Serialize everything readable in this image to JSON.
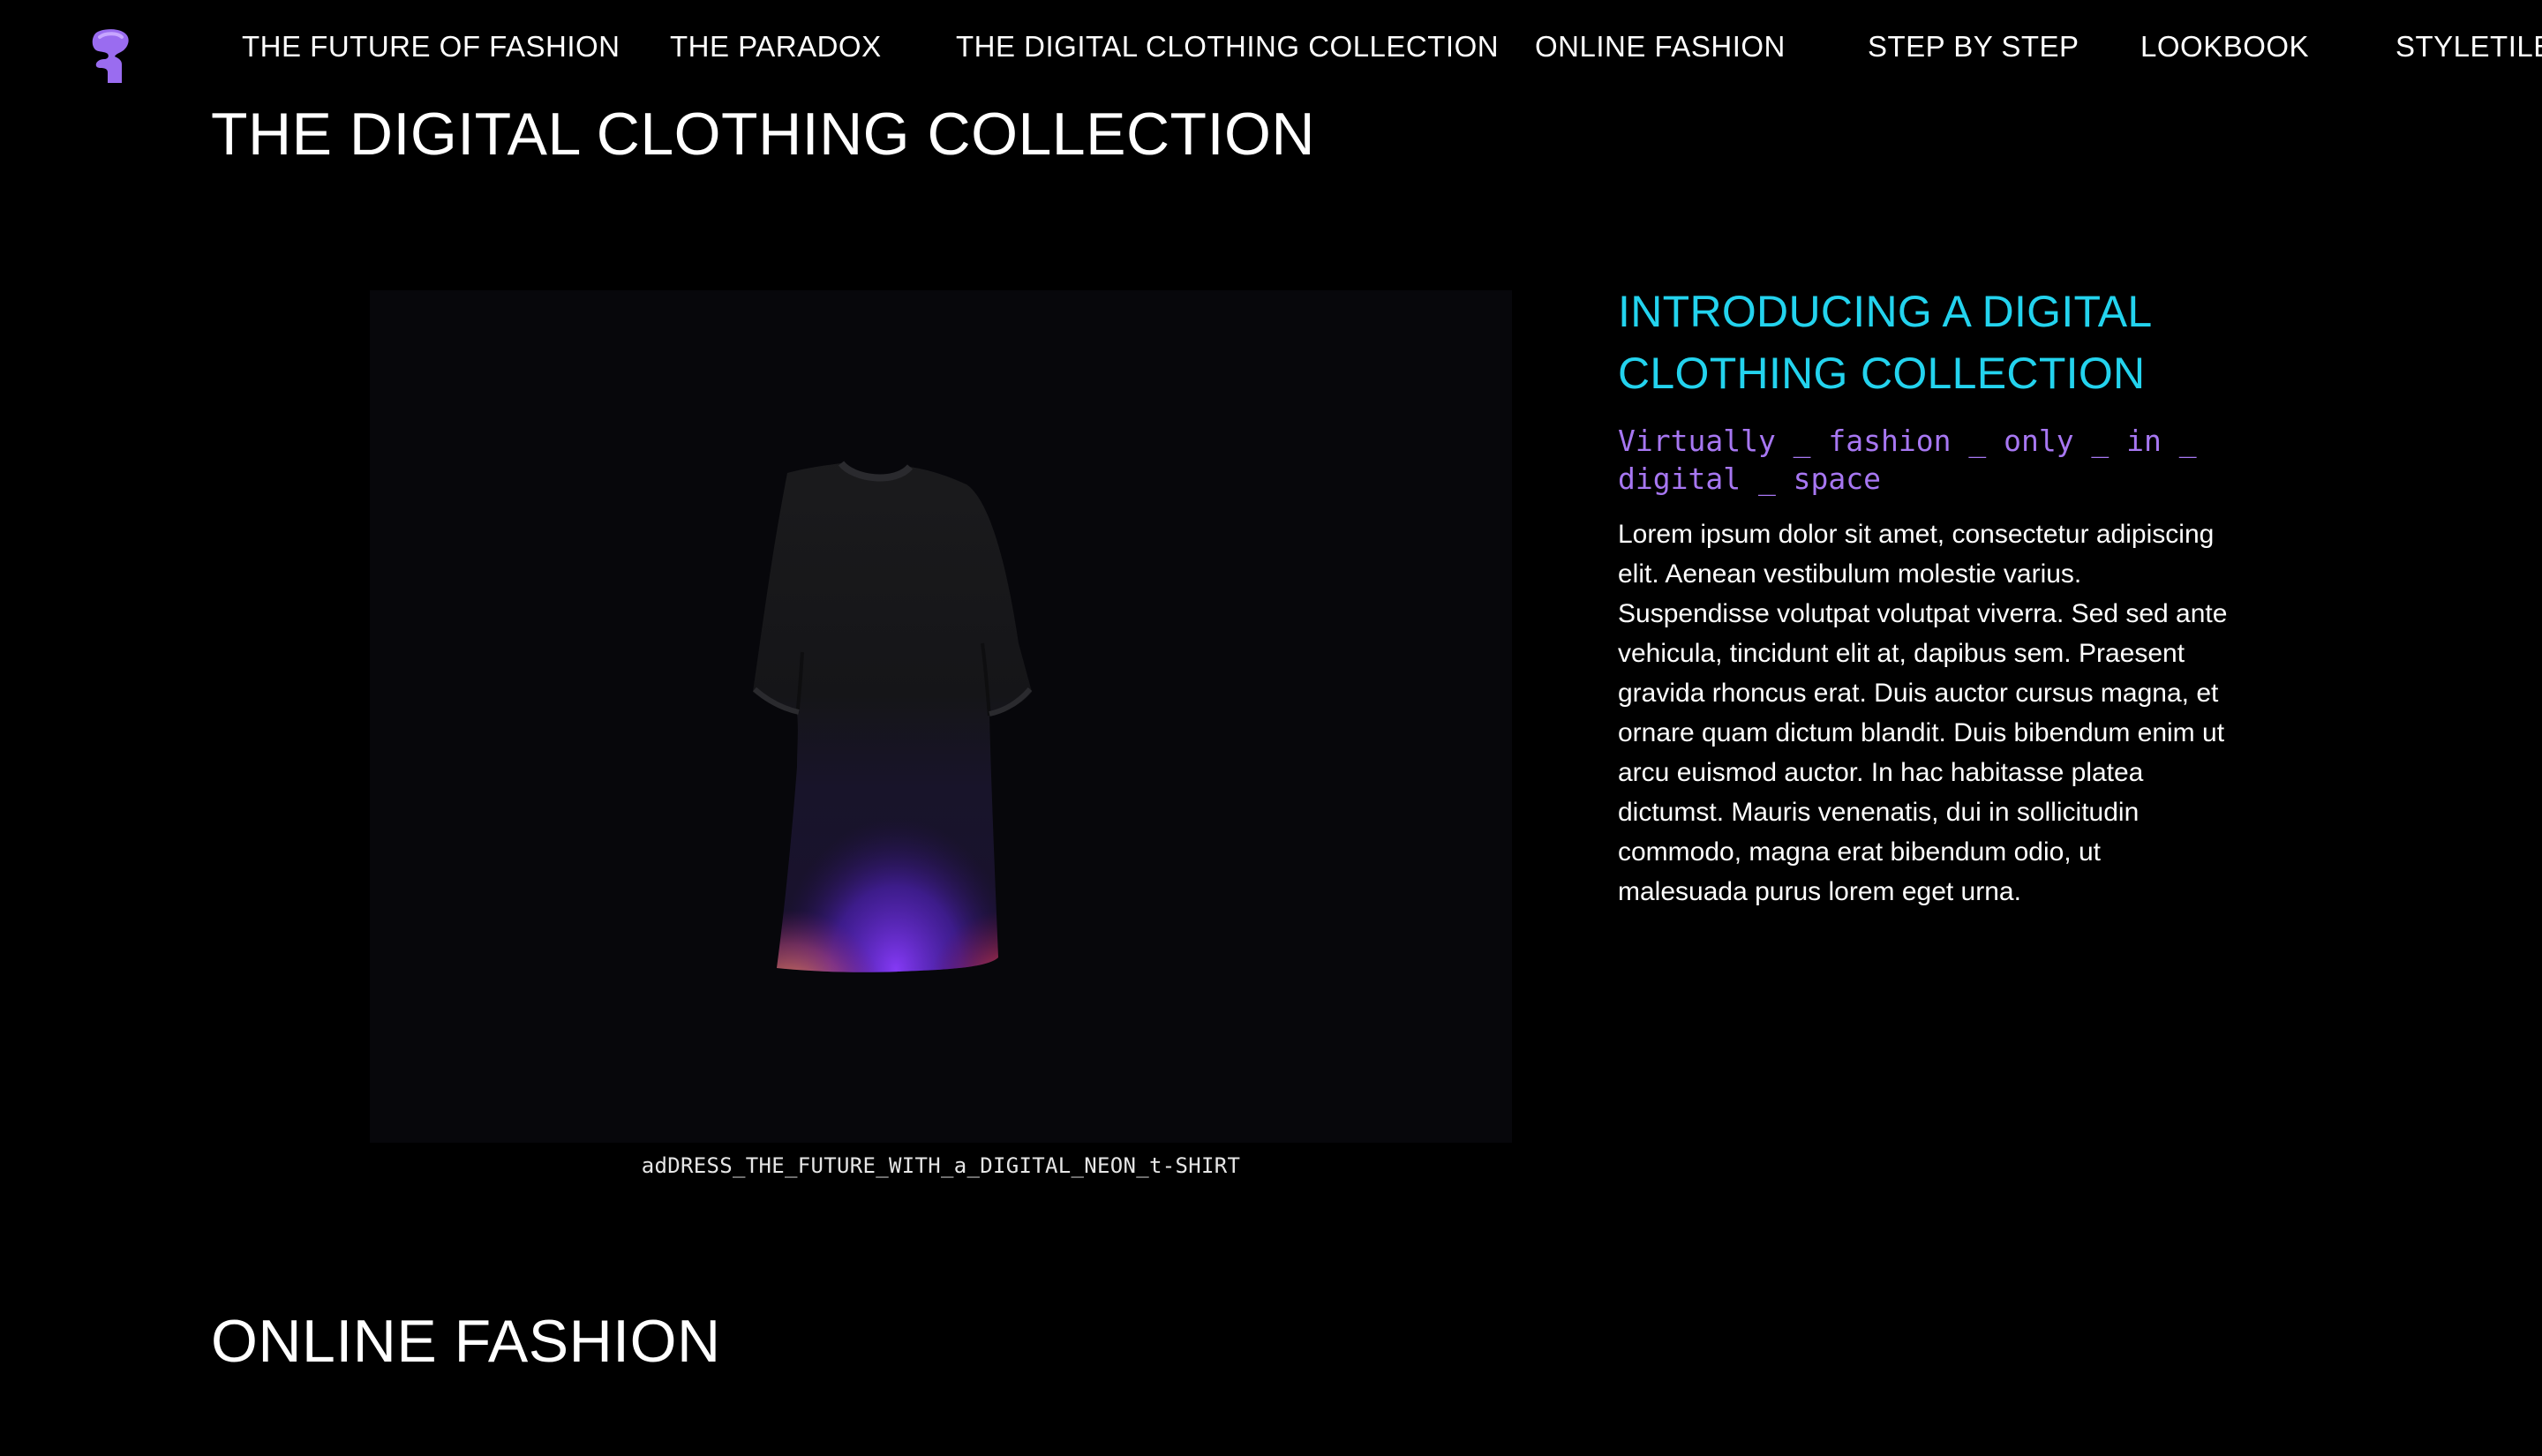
{
  "colors": {
    "background": "#000000",
    "accent_cyan": "#23d3ee",
    "accent_purple": "#a777f2",
    "logo_purple": "#9a6cf0",
    "text": "#ffffff"
  },
  "logo": {
    "icon": "head-silhouette-logo-icon"
  },
  "nav": {
    "items": [
      {
        "label": "THE FUTURE OF FASHION"
      },
      {
        "label": "THE PARADOX"
      },
      {
        "label": "THE DIGITAL CLOTHING COLLECTION"
      },
      {
        "label": "ONLINE FASHION"
      },
      {
        "label": "STEP BY STEP"
      },
      {
        "label": "LOOKBOOK"
      },
      {
        "label": "STYLETILE"
      }
    ]
  },
  "section": {
    "title": "THE DIGITAL CLOTHING COLLECTION",
    "image_caption": "adDRESS_THE_FUTURE_WITH_a_DIGITAL_NEON_t-SHIRT",
    "intro": {
      "heading": "INTRODUCING A DIGITAL CLOTHING COLLECTION",
      "subheading": "Virtually _ fashion _ only _ in _ digital _ space",
      "body": "Lorem ipsum dolor sit amet, consectetur adipiscing elit. Aenean vestibulum molestie varius. Suspendisse volutpat volutpat viverra. Sed sed ante vehicula, tincidunt elit at, dapibus sem. Praesent gravida rhoncus erat. Duis auctor cursus magna, et ornare quam dictum blandit. Duis bibendum enim ut arcu euismod auctor. In hac habitasse platea dictumst. Mauris venenatis, dui in sollicitudin commodo, magna erat bibendum odio, ut malesuada purus lorem eget urna."
    }
  },
  "next_section": {
    "title": "ONLINE FASHION"
  }
}
